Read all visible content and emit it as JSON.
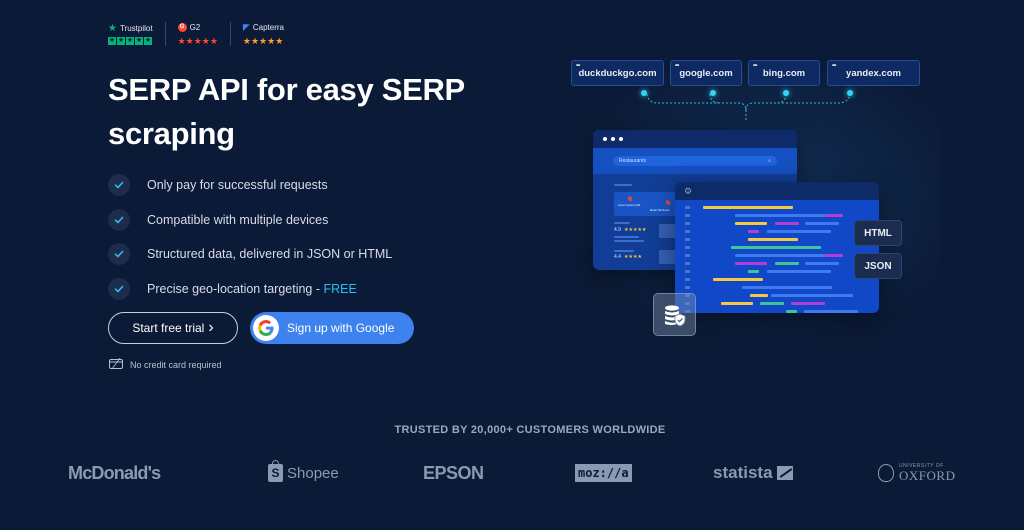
{
  "ratings": {
    "trustpilot": {
      "name": "Trustpilot",
      "stars": 5
    },
    "g2": {
      "name": "G2",
      "logo_letter": "G",
      "stars_text": "★★★★★",
      "stars": 4.5
    },
    "capterra": {
      "name": "Capterra",
      "stars_text": "★★★★★",
      "stars": 5
    }
  },
  "hero": {
    "title": "SERP API for easy SERP scraping",
    "features": [
      {
        "text": "Only pay for successful requests"
      },
      {
        "text": "Compatible with multiple devices"
      },
      {
        "text": "Structured data, delivered in JSON or HTML"
      },
      {
        "text": "Precise geo-location targeting",
        "suffix": " - ",
        "highlight": "FREE"
      }
    ],
    "cta_trial": "Start free trial",
    "cta_trial_chevron": "›",
    "cta_google": "Sign up with Google",
    "google_letter": "G",
    "no_card": "No credit card required"
  },
  "illustration": {
    "engines": [
      "duckduckgo.com",
      "google.com",
      "bing.com",
      "yandex.com"
    ],
    "engine_dots": "•••",
    "search_query": "Restaurants",
    "result_1_rating": "4.9",
    "result_1_stars": "★★★★★",
    "result_2_rating": "4.4",
    "result_2_stars": "★★★★",
    "map_label_1": "Lorem Ipsum Rd.",
    "map_label_2": "Dolor Sit Amet",
    "formats": [
      "HTML",
      "JSON"
    ],
    "gear": "⚙"
  },
  "colors": {
    "background": "#0b1a36",
    "accent": "#27c0f0",
    "google_button": "#3e82f0",
    "trustpilot_green": "#00b67a",
    "g2_red": "#ff492c",
    "capterra_orange": "#ff9d28"
  },
  "trusted": {
    "heading": "TRUSTED BY 20,000+ CUSTOMERS WORLDWIDE",
    "logos": {
      "mcdonalds": "McDonald's",
      "shopee": "Shopee",
      "shopee_mark": "S",
      "epson": "EPSON",
      "mozilla": "moz://a",
      "statista": "statista",
      "oxford_small": "UNIVERSITY OF",
      "oxford_big": "OXFORD"
    }
  }
}
